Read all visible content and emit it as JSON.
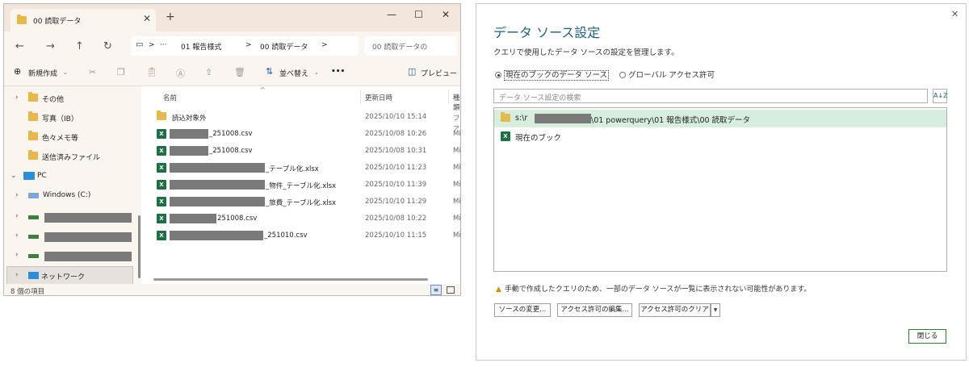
{
  "explorer": {
    "tab_title": "00 読取データ",
    "new_tab": "+",
    "window_controls": {
      "minimize": "—",
      "maximize": "☐",
      "close": "✕"
    },
    "nav": {
      "back": "←",
      "forward": "→",
      "up": "↑",
      "refresh": "↻",
      "more": "···"
    },
    "breadcrumb": [
      "01 報告様式",
      "00 読取データ"
    ],
    "breadcrumb_sep": ">",
    "search_placeholder": "00 読取データの",
    "toolbar": {
      "new_label": "新規作成",
      "sort_label": "並べ替え",
      "more": "•••",
      "preview_label": "プレビュー"
    },
    "sidebar": {
      "items": [
        {
          "label": "その他",
          "icon": "folder-user-icon"
        },
        {
          "label": "写真（IB）",
          "icon": "folder-user-icon"
        },
        {
          "label": "色々メモ等",
          "icon": "folder-user-icon"
        },
        {
          "label": "送信済みファイル",
          "icon": "folder-user-icon"
        },
        {
          "label": "PC",
          "icon": "pc-icon"
        },
        {
          "label": "Windows (C:)",
          "icon": "drive-icon"
        },
        {
          "label": "",
          "icon": "drive-icon"
        },
        {
          "label": "",
          "icon": "drive-icon"
        },
        {
          "label": "",
          "icon": "drive-icon"
        },
        {
          "label": "ネットワーク",
          "icon": "network-icon"
        }
      ]
    },
    "columns": {
      "name": "名前",
      "modified": "更新日時",
      "type": "種類"
    },
    "files": [
      {
        "name": "読込対象外",
        "modified": "2025/10/10 15:14",
        "type": "ファ",
        "icon": "folder-icon"
      },
      {
        "name": "_251008.csv",
        "modified": "2025/10/08 10:26",
        "type": "Mic",
        "icon": "excel-icon"
      },
      {
        "name": "_251008.csv",
        "modified": "2025/10/08 10:31",
        "type": "Mic",
        "icon": "excel-icon"
      },
      {
        "name": "_テーブル化.xlsx",
        "modified": "2025/10/10 11:23",
        "type": "Mic",
        "icon": "excel-icon"
      },
      {
        "name": "_物件_テーブル化.xlsx",
        "modified": "2025/10/10 11:39",
        "type": "Mic",
        "icon": "excel-icon"
      },
      {
        "name": "_旅費_テーブル化.xlsx",
        "modified": "2025/10/10 11:29",
        "type": "Mic",
        "icon": "excel-icon"
      },
      {
        "name": "251008.csv",
        "modified": "2025/10/08 10:22",
        "type": "Mic",
        "icon": "excel-icon"
      },
      {
        "name": "_251010.csv",
        "modified": "2025/10/10 11:15",
        "type": "Mic",
        "icon": "excel-icon"
      }
    ],
    "status": "8 個の項目"
  },
  "dialog": {
    "title": "データ ソース設定",
    "description": "クエリで使用したデータ ソースの設定を管理します。",
    "radio_current": "現在のブックのデータ ソース",
    "radio_global": "グローバル アクセス許可",
    "search_placeholder": "データ ソース設定の検索",
    "sources": [
      {
        "prefix": "s:\\r",
        "suffix": "\\01 powerquery\\01 報告様式\\00 読取データ",
        "icon": "folder-icon"
      },
      {
        "prefix": "現在のブック",
        "suffix": "",
        "icon": "excel-icon"
      }
    ],
    "warning": "手動で作成したクエリのため、一部のデータ ソースが一覧に表示されない可能性があります。",
    "buttons": {
      "change_source": "ソースの変更...",
      "edit_permissions": "アクセス許可の編集...",
      "clear_permissions": "アクセス許可のクリア",
      "close": "閉じる"
    }
  }
}
